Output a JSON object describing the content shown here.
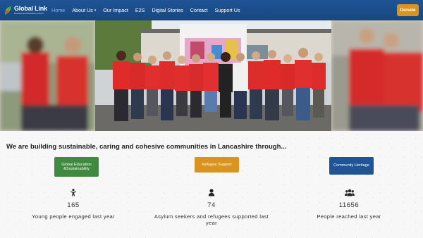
{
  "logo": {
    "title": "Global Link",
    "subtitle": "Development Education Centre"
  },
  "nav": {
    "items": [
      "Home",
      "About Us",
      "Our Impact",
      "E2S",
      "Digital Stories",
      "Contact",
      "Support Us"
    ],
    "active": "Home",
    "dropdown_item": "About Us"
  },
  "donate_label": "Donate",
  "colors": {
    "navbar": "#1f5495",
    "donate": "#d9931f",
    "education": "#3f8a3f",
    "refugee": "#d9931f",
    "heritage": "#1f5495"
  },
  "carousel": {
    "slides": 6,
    "active_index": 0
  },
  "heading": "We are building sustainable, caring and cohesive communities in Lancashire through...",
  "categories": [
    {
      "label": "Global Education &Sustainability",
      "icon": "child-icon",
      "value": "165",
      "caption": "Young people engaged last year"
    },
    {
      "label": "Refugee Support",
      "icon": "person-icon",
      "value": "74",
      "caption": "Asylum seekers and refugees supported last year"
    },
    {
      "label": "Community Heritage",
      "icon": "group-icon",
      "value": "11656",
      "caption": "People reached last year"
    }
  ]
}
